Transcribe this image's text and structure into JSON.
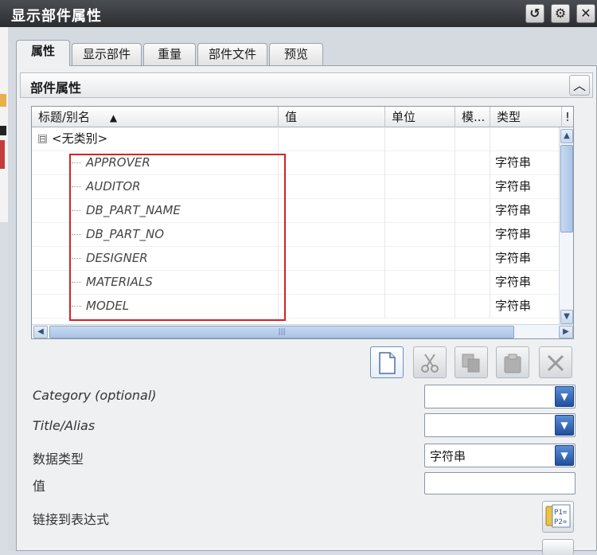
{
  "window": {
    "title": "显示部件属性",
    "buttons": [
      {
        "name": "reset-icon",
        "glyph": "↺"
      },
      {
        "name": "gear-icon",
        "glyph": "⚙"
      },
      {
        "name": "close-icon",
        "glyph": "✕"
      }
    ]
  },
  "tabs": [
    {
      "label": "属性",
      "active": true
    },
    {
      "label": "显示部件",
      "active": false
    },
    {
      "label": "重量",
      "active": false
    },
    {
      "label": "部件文件",
      "active": false
    },
    {
      "label": "预览",
      "active": false
    }
  ],
  "group": {
    "title": "部件属性",
    "collapse_glyph": "︿"
  },
  "table": {
    "columns": [
      "标题/别名",
      "值",
      "单位",
      "模...",
      "类型",
      "!"
    ],
    "sort_indicator": "▲",
    "category_row": {
      "label": "<无类别>",
      "expander": "⊟"
    },
    "rows": [
      {
        "name": "APPROVER",
        "value": "",
        "unit": "",
        "mode": "",
        "type": "字符串"
      },
      {
        "name": "AUDITOR",
        "value": "",
        "unit": "",
        "mode": "",
        "type": "字符串"
      },
      {
        "name": "DB_PART_NAME",
        "value": "",
        "unit": "",
        "mode": "",
        "type": "字符串"
      },
      {
        "name": "DB_PART_NO",
        "value": "",
        "unit": "",
        "mode": "",
        "type": "字符串"
      },
      {
        "name": "DESIGNER",
        "value": "",
        "unit": "",
        "mode": "",
        "type": "字符串"
      },
      {
        "name": "MATERIALS",
        "value": "",
        "unit": "",
        "mode": "",
        "type": "字符串"
      },
      {
        "name": "MODEL",
        "value": "",
        "unit": "",
        "mode": "",
        "type": "字符串"
      }
    ],
    "scrollbar_glyphs": {
      "up": "▲",
      "down": "▼",
      "left": "◀",
      "right": "▶",
      "grip": "|||"
    }
  },
  "toolbar": {
    "tools": [
      {
        "name": "new-attribute-icon",
        "active": true
      },
      {
        "name": "cut-icon",
        "active": false
      },
      {
        "name": "copy-icon",
        "active": false
      },
      {
        "name": "paste-icon",
        "active": false
      },
      {
        "name": "delete-icon",
        "active": false
      }
    ]
  },
  "form": {
    "category_label": "Category (optional)",
    "category_value": "",
    "title_label": "Title/Alias",
    "title_value": "",
    "datatype_label": "数据类型",
    "datatype_value": "字符串",
    "value_label": "值",
    "value_value": "",
    "expression_label": "链接到表达式",
    "dropdown_glyph": "▼",
    "expr_icon_text_1": "P1=",
    "expr_icon_text_2": "P2="
  },
  "colors": {
    "highlight_box": "#d62222",
    "dropdown_accent": "#1f4f9e",
    "scroll_accent": "#a9c3e6"
  }
}
